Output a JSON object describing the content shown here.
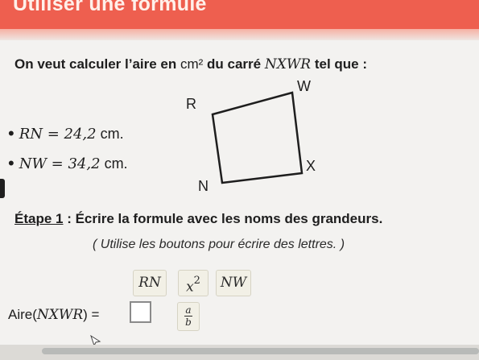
{
  "header": {
    "title": "Utiliser une formule"
  },
  "intro": {
    "prefix": "On veut calculer l’aire en ",
    "unit": "cm²",
    "middle": " du carré ",
    "shape": "NXWR",
    "suffix": " tel que :"
  },
  "givens": [
    {
      "var": "RN = 24,2",
      "unit": " cm."
    },
    {
      "var": "NW = 34,2",
      "unit": " cm."
    }
  ],
  "figure": {
    "labels": {
      "R": "R",
      "W": "W",
      "X": "X",
      "N": "N"
    }
  },
  "step": {
    "heading": "Étape 1",
    "text": " : Écrire la formule avec les noms des grandeurs."
  },
  "hint": "( Utilise les boutons pour écrire des lettres. )",
  "buttons": {
    "rn": "RN",
    "power": "x",
    "power_exp": "2",
    "nw": "NW",
    "frac_num": "a",
    "frac_den": "b"
  },
  "answer": {
    "prefix": "Aire(",
    "shape": "NXWR",
    "suffix": ") ="
  }
}
